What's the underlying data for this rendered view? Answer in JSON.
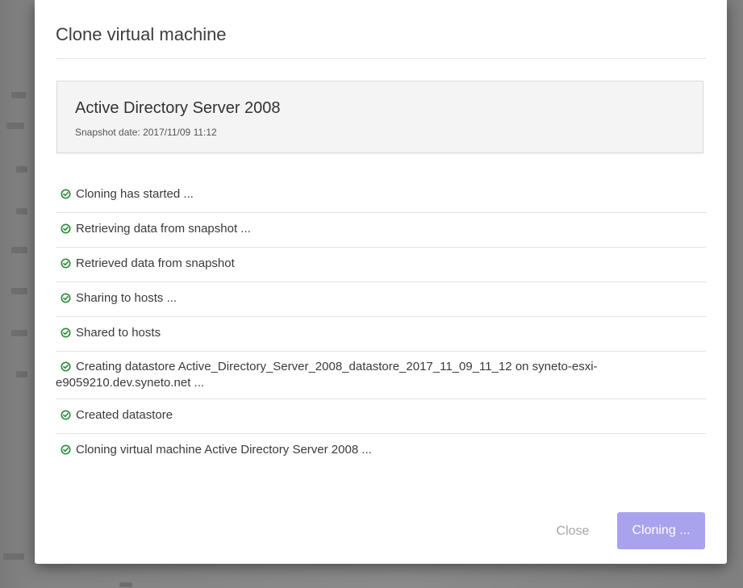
{
  "dialog": {
    "title": "Clone virtual machine"
  },
  "vm": {
    "name": "Active Directory Server 2008",
    "snapshot_date": "Snapshot date: 2017/11/09 11:12"
  },
  "steps": [
    {
      "text": "Cloning has started ...",
      "status": "done"
    },
    {
      "text": "Retrieving data from snapshot ...",
      "status": "done"
    },
    {
      "text": "Retrieved data from snapshot",
      "status": "done"
    },
    {
      "text": "Sharing to hosts ...",
      "status": "done"
    },
    {
      "text": "Shared to hosts",
      "status": "done"
    },
    {
      "text": "Creating datastore Active_Directory_Server_2008_datastore_2017_11_09_11_12 on syneto-esxi-e9059210.dev.syneto.net ...",
      "status": "done"
    },
    {
      "text": "Created datastore",
      "status": "done"
    },
    {
      "text": "Cloning virtual machine Active Directory Server 2008 ...",
      "status": "done"
    }
  ],
  "buttons": {
    "close_label": "Close",
    "cloning_label": "Cloning ..."
  },
  "colors": {
    "check_green": "#2e8b3d",
    "primary_button": "#a9a2ec"
  },
  "icons": {
    "step_status": "check-circle-icon"
  }
}
